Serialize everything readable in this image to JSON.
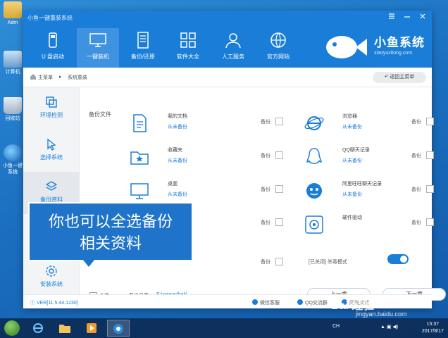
{
  "desktop": {
    "icons": [
      {
        "label": "Adm"
      },
      {
        "label": "计算机"
      },
      {
        "label": "回收站"
      },
      {
        "label": "小鱼一键系统"
      }
    ]
  },
  "window": {
    "title": "小鱼一键重装系统",
    "nav": [
      {
        "label": "U 盘启动",
        "icon": "usb-icon"
      },
      {
        "label": "一键装机",
        "icon": "monitor-icon",
        "active": true
      },
      {
        "label": "备份/还原",
        "icon": "server-icon"
      },
      {
        "label": "软件大全",
        "icon": "apps-grid-icon"
      },
      {
        "label": "人工服务",
        "icon": "support-person-icon"
      },
      {
        "label": "官方网站",
        "icon": "globe-icon"
      }
    ],
    "logo": {
      "title": "小鱼系统",
      "subtitle": "xiaoyuxitong.com"
    }
  },
  "breadcrumb": {
    "home": "主菜单",
    "separator": "▸",
    "current": "系统重装",
    "back_label": "返回主菜单"
  },
  "sidebar": {
    "items": [
      {
        "label": "环境检测"
      },
      {
        "label": "选择系统"
      },
      {
        "label": "备份资料",
        "active": true
      },
      {
        "label": "安装系统"
      }
    ]
  },
  "backup": {
    "section_label": "备份文件",
    "backup_text": "备份",
    "left_items": [
      {
        "name": "我的文档",
        "status": "从未备份"
      },
      {
        "name": "收藏夹",
        "status": "从未备份"
      },
      {
        "name": "桌面",
        "status": "从未备份"
      }
    ],
    "right_items": [
      {
        "name": "浏览器",
        "status": "从未备份"
      },
      {
        "name": "QQ聊天记录",
        "status": "从未备份"
      },
      {
        "name": "阿里旺旺聊天记录",
        "status": "从未备份"
      },
      {
        "name": "硬件驱动",
        "status": ""
      }
    ],
    "mode_label": "[已关闭] 杀毒模式",
    "select_all": "全选",
    "dir_label": "备份目录：",
    "dir_value": "E:\\xiaoyu\\bak\\",
    "prev": "上一步",
    "next": "下一步"
  },
  "status": {
    "version": "VER[11.5.44.1230]",
    "links": [
      "微信客服",
      "QQ交流群",
      "问题反馈"
    ]
  },
  "callout": {
    "line1": "你也可以全选备份",
    "line2": "相关资料"
  },
  "watermark": {
    "brand": "Bai 经验",
    "url": "jingyan.baidu.com"
  },
  "taskbar": {
    "tray": "CH",
    "time": "15:37",
    "date": "2017/8/17"
  },
  "colors": {
    "accent": "#1a7ed9",
    "callout": "#1f74c9"
  }
}
